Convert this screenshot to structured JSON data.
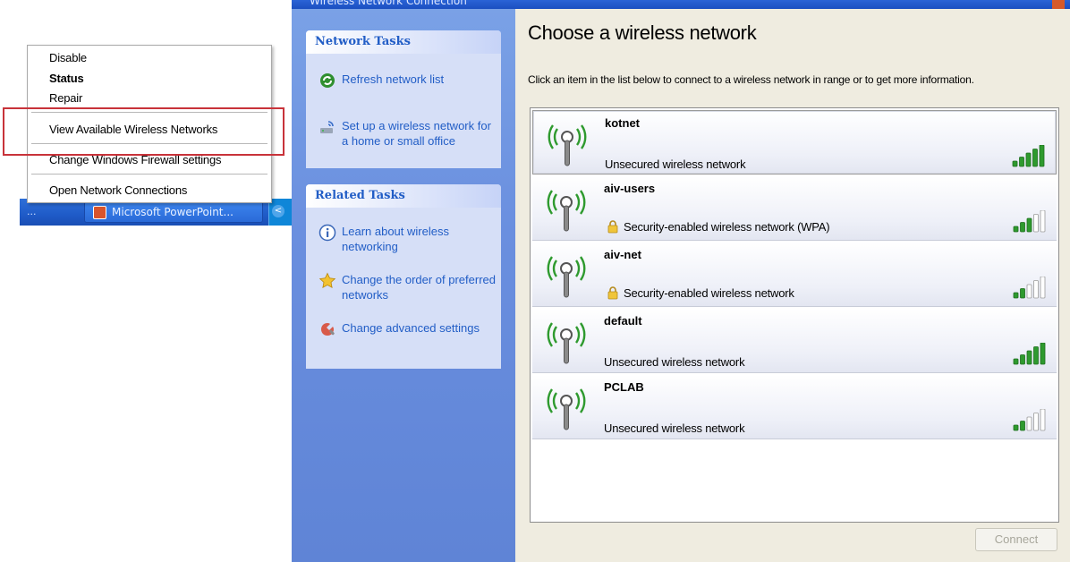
{
  "taskbar": {
    "dots": "...",
    "task_label": "Microsoft PowerPoint...",
    "tray_arrow": "<"
  },
  "context_menu": {
    "items": [
      {
        "label": "Disable",
        "bold": false
      },
      {
        "label": "Status",
        "bold": true
      },
      {
        "label": "Repair",
        "bold": false
      },
      {
        "label": "View Available Wireless Networks",
        "bold": false
      },
      {
        "label": "Change Windows Firewall settings",
        "bold": false
      },
      {
        "label": "Open Network Connections",
        "bold": false
      }
    ],
    "highlight_color": "#c8333a"
  },
  "window": {
    "title": "Wireless Network Connection"
  },
  "task_pane": {
    "network_tasks": {
      "header": "Network Tasks",
      "items": [
        {
          "label": "Refresh network list",
          "icon": "refresh-icon"
        },
        {
          "label": "Set up a wireless network for a home or small office",
          "icon": "setup-network-icon"
        }
      ]
    },
    "related_tasks": {
      "header": "Related Tasks",
      "items": [
        {
          "label": "Learn about wireless networking",
          "icon": "info-icon"
        },
        {
          "label": "Change the order of preferred networks",
          "icon": "star-icon"
        },
        {
          "label": "Change advanced settings",
          "icon": "settings-icon"
        }
      ]
    }
  },
  "main": {
    "heading": "Choose a wireless network",
    "instructions": "Click an item in the list below to connect to a wireless network in range or to get more information.",
    "networks": [
      {
        "name": "kotnet",
        "status": "Unsecured wireless network",
        "secured": false,
        "signal_bars": 5,
        "selected": true
      },
      {
        "name": "aiv-users",
        "status": "Security-enabled wireless network (WPA)",
        "secured": true,
        "signal_bars": 3,
        "selected": false
      },
      {
        "name": "aiv-net",
        "status": "Security-enabled wireless network",
        "secured": true,
        "signal_bars": 2,
        "selected": false
      },
      {
        "name": "default",
        "status": "Unsecured wireless network",
        "secured": false,
        "signal_bars": 5,
        "selected": false
      },
      {
        "name": "PCLAB",
        "status": "Unsecured wireless network",
        "secured": false,
        "signal_bars": 2,
        "selected": false
      }
    ],
    "connect_label": "Connect"
  },
  "colors": {
    "link_blue": "#215dc6",
    "signal_green": "#2e9a2e",
    "signal_empty": "#c8c8c8",
    "task_pane_blue": "#6a8fdf"
  }
}
